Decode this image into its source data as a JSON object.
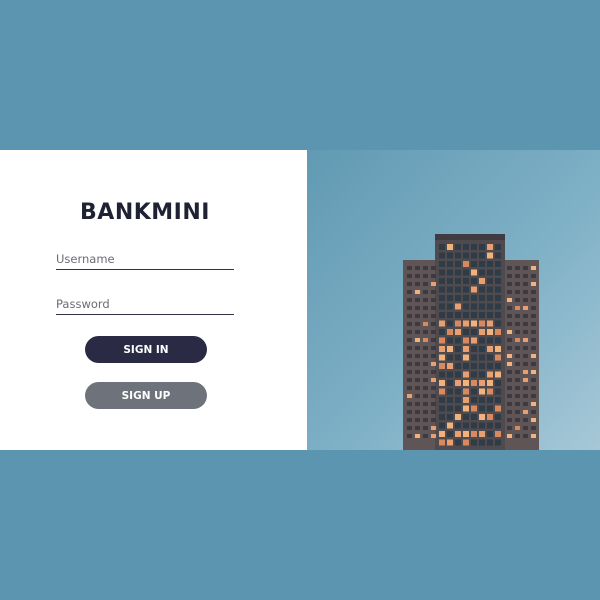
{
  "brand": {
    "title": "BANKMINI"
  },
  "form": {
    "username_placeholder": "Username",
    "password_placeholder": "Password",
    "signin_label": "SIGN IN",
    "signup_label": "SIGN UP"
  },
  "colors": {
    "page_background": "#5b95b0",
    "card_background": "#ffffff",
    "signin_button": "#2a2a44",
    "signup_button": "#6e737b"
  },
  "photo": {
    "subject": "tower-building-image"
  }
}
